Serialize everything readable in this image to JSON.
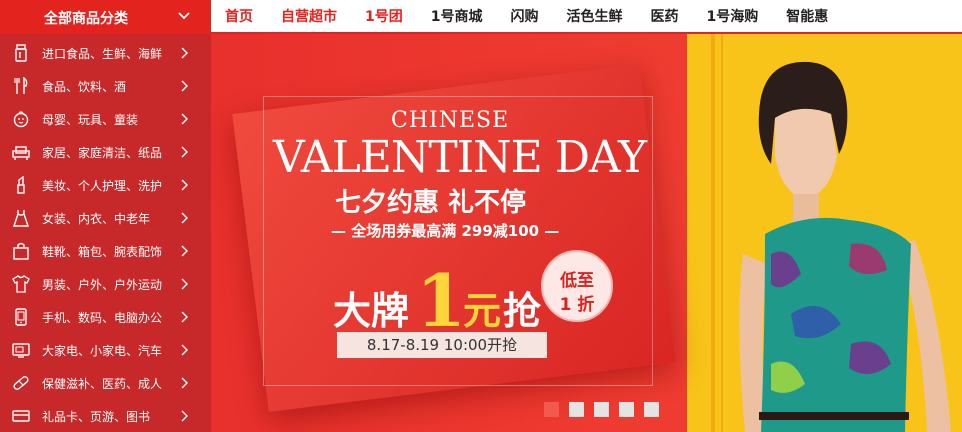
{
  "nav": {
    "category_title": "全部商品分类",
    "items": [
      {
        "label": "首页",
        "highlight": true
      },
      {
        "label": "自营超市",
        "highlight": true
      },
      {
        "label": "1号团",
        "highlight": true
      },
      {
        "label": "1号商城",
        "highlight": false
      },
      {
        "label": "闪购",
        "highlight": false
      },
      {
        "label": "活色生鲜",
        "highlight": false
      },
      {
        "label": "医药",
        "highlight": false
      },
      {
        "label": "1号海购",
        "highlight": false
      },
      {
        "label": "智能惠",
        "highlight": false
      }
    ]
  },
  "sidebar": {
    "items": [
      {
        "label": "进口食品、生鲜、海鲜",
        "icon": "jar-icon"
      },
      {
        "label": "食品、饮料、酒",
        "icon": "utensils-icon"
      },
      {
        "label": "母婴、玩具、童装",
        "icon": "baby-icon"
      },
      {
        "label": "家居、家庭清洁、纸品",
        "icon": "sofa-icon"
      },
      {
        "label": "美妆、个人护理、洗护",
        "icon": "lipstick-icon"
      },
      {
        "label": "女装、内衣、中老年",
        "icon": "dress-icon"
      },
      {
        "label": "鞋靴、箱包、腕表配饰",
        "icon": "bag-icon"
      },
      {
        "label": "男装、户外、户外运动",
        "icon": "shirt-icon"
      },
      {
        "label": "手机、数码、电脑办公",
        "icon": "phone-icon"
      },
      {
        "label": "大家电、小家电、汽车",
        "icon": "tv-icon"
      },
      {
        "label": "保健滋补、医药、成人",
        "icon": "pill-icon"
      },
      {
        "label": "礼品卡、页游、图书",
        "icon": "gift-card-icon"
      }
    ]
  },
  "banner": {
    "chinese": "CHINESE",
    "valentine": "VALENTINE DAY",
    "qixi": "七夕约惠 礼不停",
    "coupon": "— 全场用券最高满 299减100 —",
    "big_brand": "大牌",
    "one": "1",
    "yuan": "元",
    "qiang": "抢",
    "badge_line1": "低至",
    "badge_line2": "1 折",
    "date": "8.17-8.19  10:00开抢",
    "slide_count": 5,
    "active_slide": 1
  },
  "colors": {
    "brand_red": "#e3231e",
    "sidebar_red": "#c7282a",
    "accent_yellow": "#ffd53a",
    "banner_yellow": "#f9c41a"
  }
}
